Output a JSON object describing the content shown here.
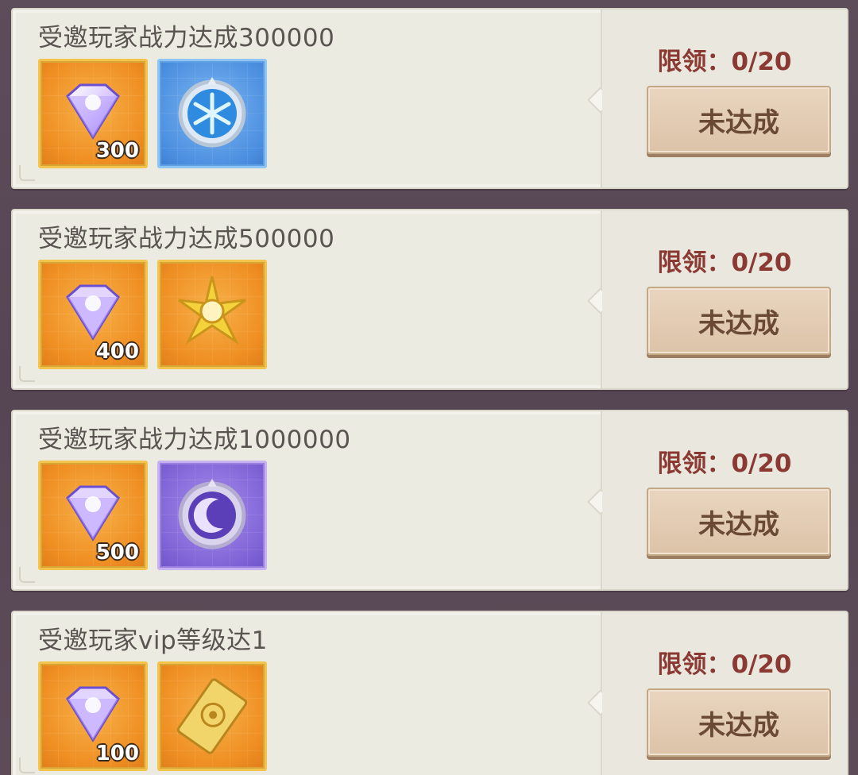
{
  "tasks": [
    {
      "title": "受邀玩家战力达成300000",
      "rewards": [
        {
          "icon": "diamond-icon",
          "frame": "gold",
          "qty": "300"
        },
        {
          "icon": "snowflake-emblem-icon",
          "frame": "blue",
          "qty": ""
        }
      ],
      "limit_label": "限领：",
      "limit_value": "0/20",
      "button_label": "未达成"
    },
    {
      "title": "受邀玩家战力达成500000",
      "rewards": [
        {
          "icon": "diamond-icon",
          "frame": "gold",
          "qty": "400"
        },
        {
          "icon": "golden-star-emblem-icon",
          "frame": "gold",
          "qty": ""
        }
      ],
      "limit_label": "限领：",
      "limit_value": "0/20",
      "button_label": "未达成"
    },
    {
      "title": "受邀玩家战力达成1000000",
      "rewards": [
        {
          "icon": "diamond-icon",
          "frame": "gold",
          "qty": "500"
        },
        {
          "icon": "moon-emblem-icon",
          "frame": "purple",
          "qty": ""
        }
      ],
      "limit_label": "限领：",
      "limit_value": "0/20",
      "button_label": "未达成"
    },
    {
      "title": "受邀玩家vip等级达1",
      "rewards": [
        {
          "icon": "diamond-icon",
          "frame": "gold",
          "qty": "100"
        },
        {
          "icon": "golden-card-icon",
          "frame": "gold",
          "qty": ""
        }
      ],
      "limit_label": "限领：",
      "limit_value": "0/20",
      "button_label": "未达成"
    }
  ],
  "colors": {
    "panel_bg": "#ecebe2",
    "title_text": "#5a5451",
    "limit_text": "#8a3a32",
    "button_bg": "#e3cdb4",
    "button_text": "#6a4a35"
  }
}
